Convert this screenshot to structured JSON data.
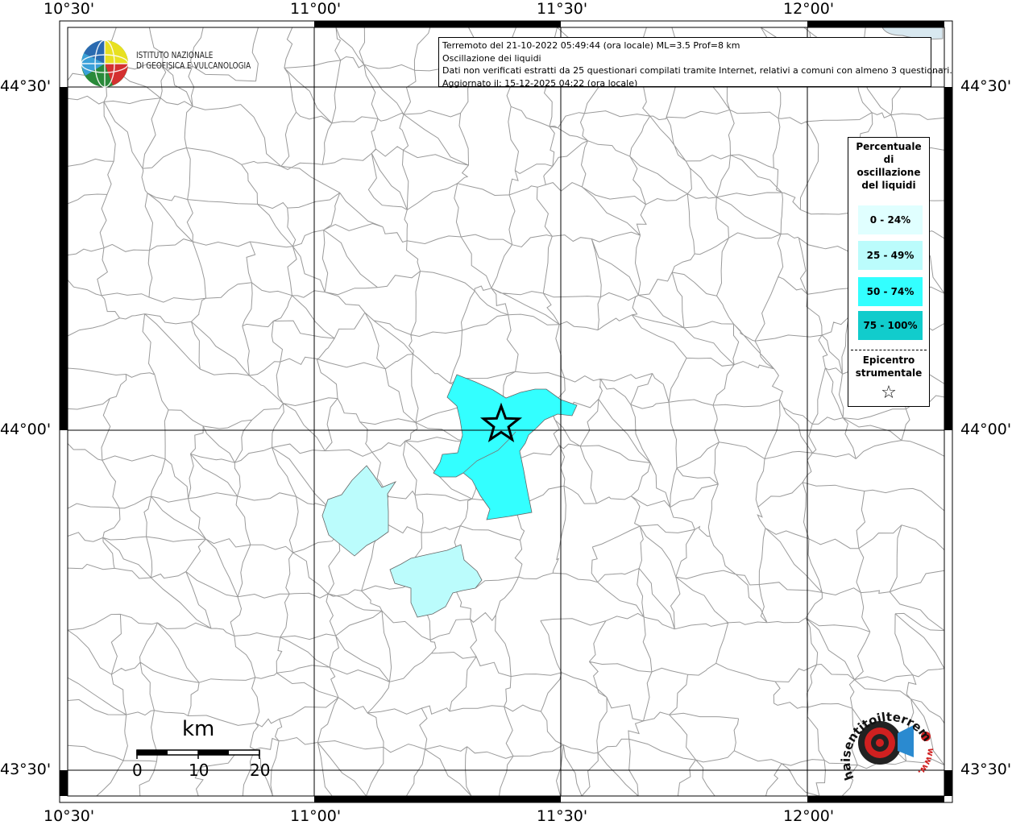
{
  "header": {
    "line1": "Terremoto del 21-10-2022 05:49:44 (ora locale) ML=3.5 Prof=8 km",
    "line2": "Oscillazione dei liquidi",
    "line3": "Dati non verificati estratti da 25 questionari compilati tramite Internet, relativi a comuni con almeno 3 questionari.",
    "line4": "Aggiornato il: 15-12-2025 04:22 (ora locale)"
  },
  "ingv": {
    "line1": "ISTITUTO NAZIONALE",
    "line2": "DI GEOFISICA E VULCANOLOGIA"
  },
  "axes": {
    "top": [
      "10°30'",
      "11°00'",
      "11°30'",
      "12°00'"
    ],
    "bottom": [
      "10°30'",
      "11°00'",
      "11°30'",
      "12°00'"
    ],
    "left": [
      "44°30'",
      "44°00'",
      "43°30'"
    ],
    "right": [
      "44°30'",
      "44°00'",
      "43°30'"
    ]
  },
  "legend": {
    "title": "Percentuale di oscillazione del liquidi",
    "classes": [
      {
        "label": "0 - 24%",
        "color": "#e0ffff"
      },
      {
        "label": "25 - 49%",
        "color": "#bbfcfc"
      },
      {
        "label": "50 - 74%",
        "color": "#33ffff"
      },
      {
        "label": "75 - 100%",
        "color": "#11cccc"
      }
    ],
    "epicenter_label": "Epicentro strumentale",
    "epicenter_symbol": "☆"
  },
  "scale": {
    "unit": "km",
    "labels": [
      "0",
      "10",
      "20"
    ]
  },
  "colors": {
    "border": "#999999",
    "grid": "#000000",
    "high": "#33ffff",
    "low": "#bbfcfc"
  },
  "logo": {
    "hst_text": "haisentitoilterremoto.it",
    "hst_url": "www."
  }
}
